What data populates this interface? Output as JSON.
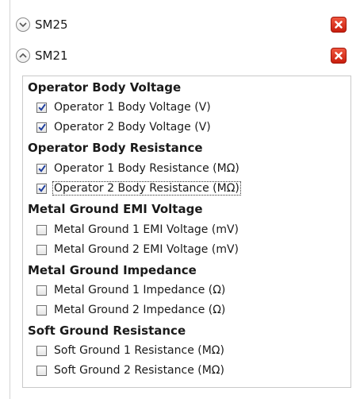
{
  "devices": [
    {
      "label": "SM25",
      "expanded": false
    },
    {
      "label": "SM21",
      "expanded": true
    }
  ],
  "groups": [
    {
      "heading": "Operator Body Voltage",
      "items": [
        {
          "label": "Operator 1 Body Voltage (V)",
          "checked": true
        },
        {
          "label": "Operator 2 Body Voltage (V)",
          "checked": true
        }
      ]
    },
    {
      "heading": "Operator Body Resistance",
      "items": [
        {
          "label": "Operator 1 Body Resistance (MΩ)",
          "checked": true
        },
        {
          "label": "Operator 2 Body Resistance (MΩ)",
          "checked": true,
          "focused": true
        }
      ]
    },
    {
      "heading": "Metal Ground EMI Voltage",
      "items": [
        {
          "label": "Metal Ground 1 EMI Voltage (mV)",
          "checked": false
        },
        {
          "label": "Metal Ground 2 EMI Voltage (mV)",
          "checked": false
        }
      ]
    },
    {
      "heading": "Metal Ground Impedance",
      "items": [
        {
          "label": "Metal Ground 1 Impedance (Ω)",
          "checked": false
        },
        {
          "label": "Metal Ground 2 Impedance (Ω)",
          "checked": false
        }
      ]
    },
    {
      "heading": "Soft Ground Resistance",
      "items": [
        {
          "label": "Soft Ground 1 Resistance (MΩ)",
          "checked": false
        },
        {
          "label": "Soft Ground 2 Resistance (MΩ)",
          "checked": false
        }
      ]
    }
  ],
  "colors": {
    "remove_button": "#d9321f",
    "checkmark": "#1f3f9e"
  },
  "icons": {
    "collapsed_expander": "chevron-down-icon",
    "expanded_expander": "chevron-up-icon",
    "remove": "close-icon",
    "check": "checkmark-icon"
  }
}
